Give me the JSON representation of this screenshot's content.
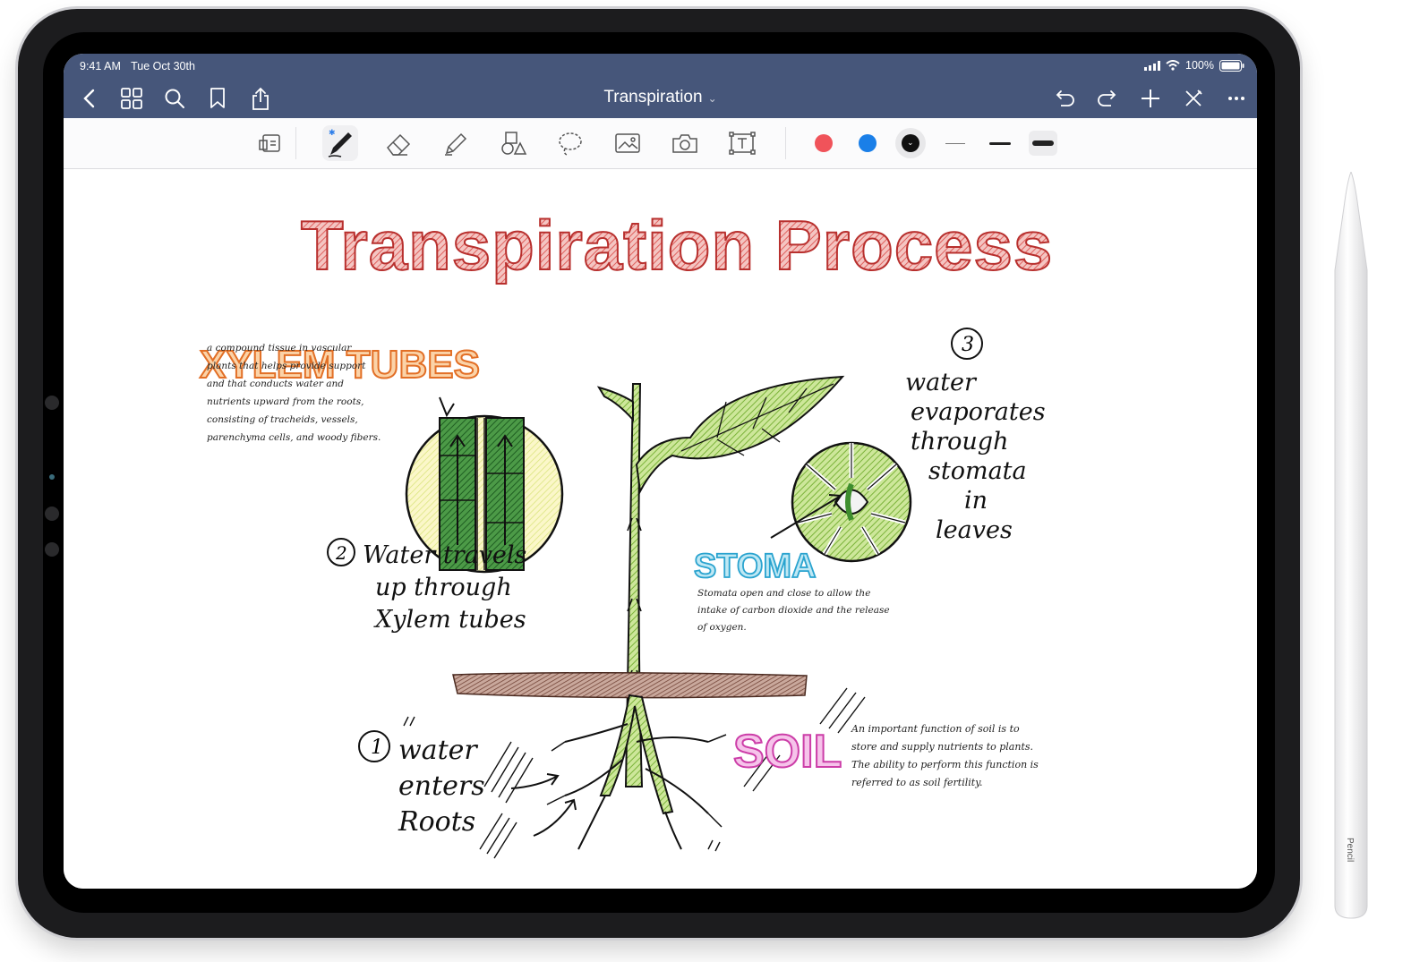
{
  "status_bar": {
    "time": "9:41 AM",
    "date": "Tue Oct 30th",
    "battery": "100%"
  },
  "nav": {
    "title": "Transpiration"
  },
  "toolbar": {
    "colors": {
      "red": "#f0535a",
      "blue": "#1a7fe8",
      "black": "#111111"
    }
  },
  "note": {
    "title": "Transpiration Process",
    "xylem_heading": "XYLEM TUBES",
    "xylem_desc": [
      "a compound tissue in vascular",
      "plants that helps provide support",
      "and that conducts water and",
      "nutrients upward from the roots,",
      "consisting of tracheids, vessels,",
      "parenchyma cells, and woody fibers."
    ],
    "step2": [
      "Water travels",
      "up through",
      "Xylem tubes"
    ],
    "step3_num": "3",
    "step3": [
      "water",
      "evaporates",
      "through",
      "stomata",
      "in",
      "leaves"
    ],
    "stoma_heading": "STOMA",
    "stoma_desc": [
      "Stomata open and close to allow the",
      "intake of carbon dioxide and the release",
      "of oxygen."
    ],
    "step1": [
      "water",
      "enters",
      "Roots"
    ],
    "soil_heading": "SOIL",
    "soil_desc": [
      "An important function of soil is to",
      "store and supply nutrients to plants.",
      "The ability to perform this function is",
      "referred to as soil fertility."
    ]
  },
  "pencil": {
    "label": "Pencil"
  }
}
